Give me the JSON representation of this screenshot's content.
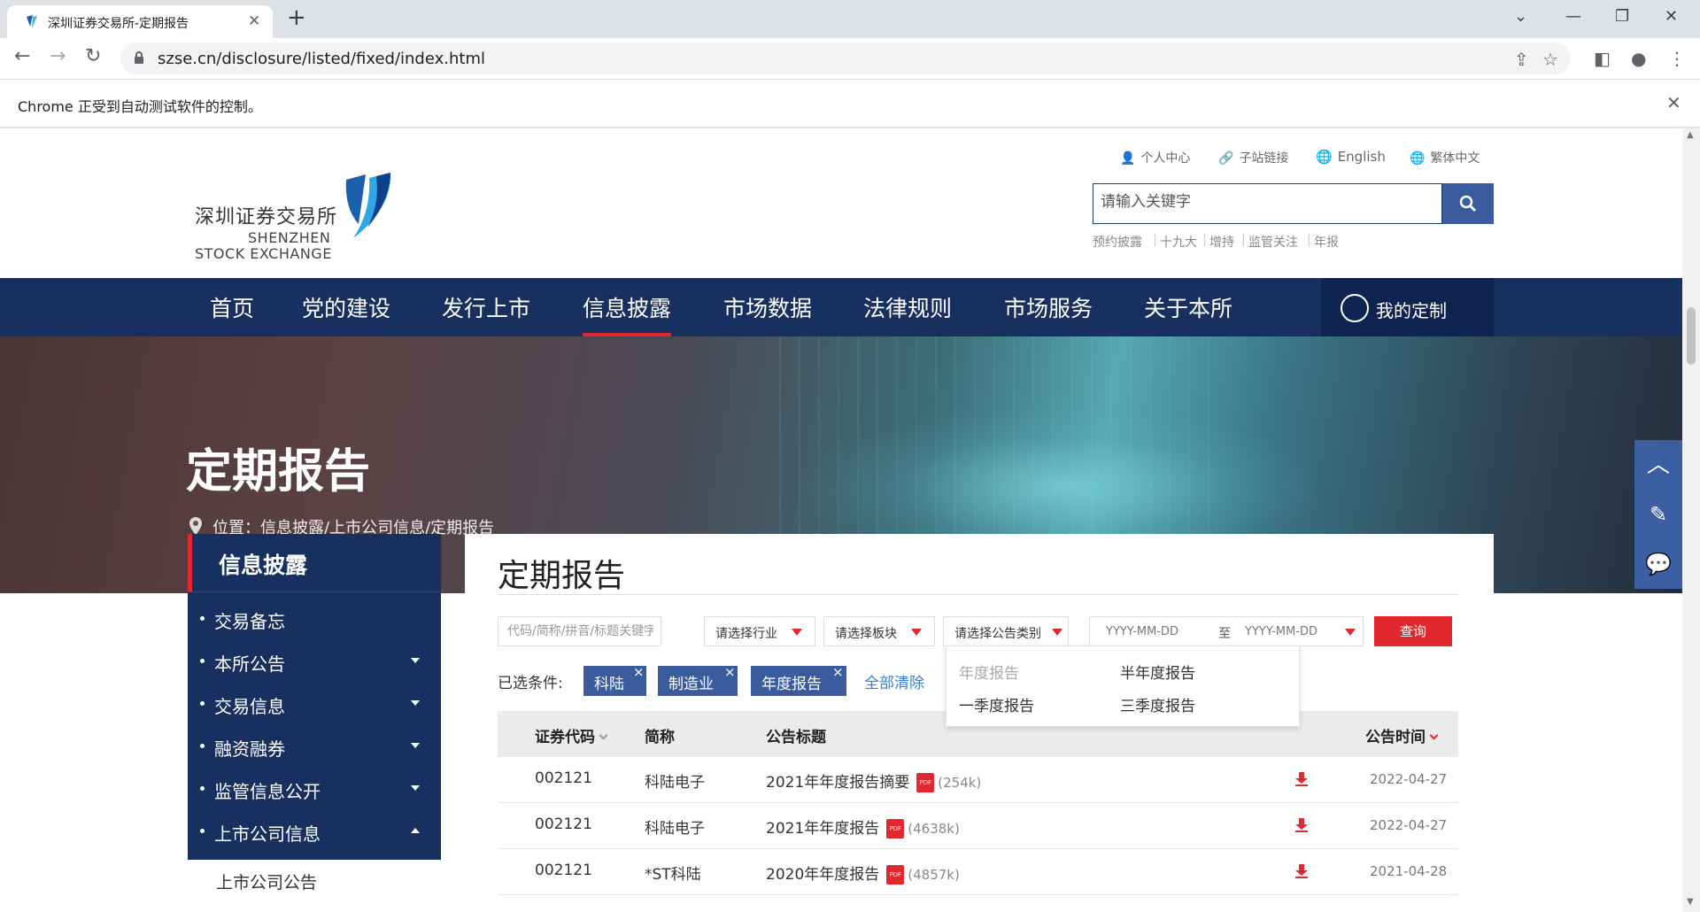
{
  "browser": {
    "tab_title": "深圳证券交易所-定期报告",
    "url": "szse.cn/disclosure/listed/fixed/index.html",
    "infobar_message": "Chrome 正受到自动测试软件的控制。"
  },
  "header": {
    "logo_cn": "深圳证券交易所",
    "logo_en_1": "SHENZHEN",
    "logo_en_2": "STOCK EXCHANGE",
    "top_links": [
      "个人中心",
      "子站链接",
      "English",
      "繁体中文"
    ],
    "search_placeholder": "请输入关键字",
    "hot_words": [
      "预约披露",
      "十九大",
      "增持",
      "监管关注",
      "年报"
    ]
  },
  "nav": {
    "items": [
      "首页",
      "党的建设",
      "发行上市",
      "信息披露",
      "市场数据",
      "法律规则",
      "市场服务",
      "关于本所"
    ],
    "active": "信息披露",
    "custom_label": "我的定制"
  },
  "banner": {
    "title": "定期报告",
    "breadcrumb": "位置：信息披露/上市公司信息/定期报告"
  },
  "left_menu": {
    "heading": "信息披露",
    "items": [
      {
        "label": "交易备忘",
        "arrow": "none"
      },
      {
        "label": "本所公告",
        "arrow": "down"
      },
      {
        "label": "交易信息",
        "arrow": "down"
      },
      {
        "label": "融资融券",
        "arrow": "down"
      },
      {
        "label": "监管信息公开",
        "arrow": "down"
      },
      {
        "label": "上市公司信息",
        "arrow": "up"
      }
    ],
    "sub_items": [
      "上市公司公告"
    ]
  },
  "content": {
    "title": "定期报告",
    "filters": {
      "keyword_placeholder": "代码/简称/拼音/标题关键字",
      "industry": "请选择行业",
      "board": "请选择板块",
      "type": "请选择公告类别",
      "date_start": "YYYY-MM-DD",
      "date_to": "至",
      "date_end": "YYYY-MM-DD",
      "query_label": "查询"
    },
    "type_options": [
      {
        "label": "年度报告",
        "selected": true
      },
      {
        "label": "半年度报告",
        "selected": false
      },
      {
        "label": "一季度报告",
        "selected": false
      },
      {
        "label": "三季度报告",
        "selected": false
      }
    ],
    "selected_label": "已选条件:",
    "selected_tags": [
      "科陆",
      "制造业",
      "年度报告"
    ],
    "clear_all": "全部清除",
    "columns": [
      "证券代码",
      "简称",
      "公告标题",
      "公告时间"
    ],
    "rows": [
      {
        "code": "002121",
        "name": "科陆电子",
        "title": "2021年年度报告摘要",
        "size": "(254k)",
        "date": "2022-04-27"
      },
      {
        "code": "002121",
        "name": "科陆电子",
        "title": "2021年年度报告",
        "size": "(4638k)",
        "date": "2022-04-27"
      },
      {
        "code": "002121",
        "name": "*ST科陆",
        "title": "2020年年度报告",
        "size": "(4857k)",
        "date": "2021-04-28"
      }
    ]
  },
  "colors": {
    "nav_bg": "#17305f",
    "accent_red": "#e0282e",
    "tag_blue": "#3a5c9e",
    "link_blue": "#3a7fd0"
  }
}
